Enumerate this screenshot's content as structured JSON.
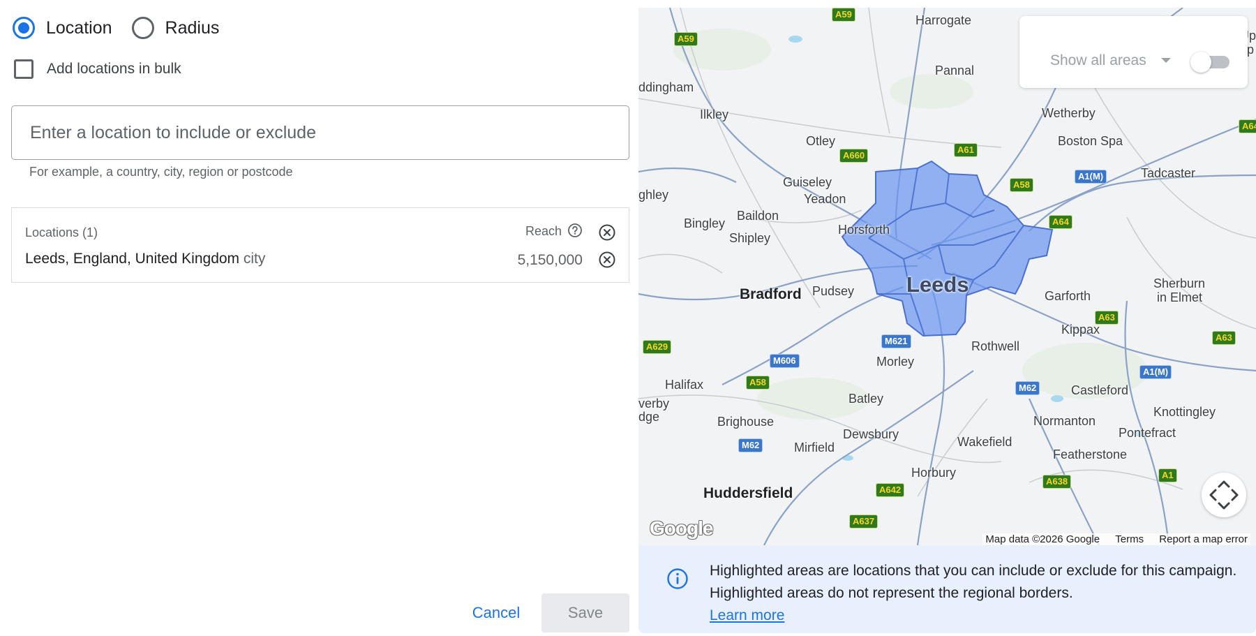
{
  "target_type": {
    "location_label": "Location",
    "radius_label": "Radius",
    "selected": "location"
  },
  "bulk": {
    "label": "Add locations in bulk",
    "checked": false
  },
  "search": {
    "placeholder": "Enter a location to include or exclude",
    "value": "",
    "helper": "For example, a country, city, region or postcode"
  },
  "locations": {
    "header": "Locations (1)",
    "reach_label": "Reach",
    "items": [
      {
        "name": "Leeds, England, United Kingdom",
        "type": "city",
        "reach": "5,150,000"
      }
    ]
  },
  "actions": {
    "cancel_label": "Cancel",
    "save_label": "Save",
    "save_disabled": true
  },
  "map": {
    "show_all_areas_label": "Show all areas",
    "show_all_areas_on": false,
    "highlight_color": "#6b96f0",
    "places": {
      "harrogate": "Harrogate",
      "pannal": "Pannal",
      "addingham": "ddingham",
      "ilkley": "Ilkley",
      "otley": "Otley",
      "wetherby": "Wetherby",
      "boston_spa": "Boston Spa",
      "tadcaster": "Tadcaster",
      "guiseley": "Guiseley",
      "yeadon": "Yeadon",
      "ghley": "ghley",
      "bingley": "Bingley",
      "baildon": "Baildon",
      "shipley": "Shipley",
      "horsforth": "Horsforth",
      "leeds": "Leeds",
      "bradford": "Bradford",
      "pudsey": "Pudsey",
      "garforth": "Garforth",
      "sherburn": "Sherburn",
      "in_elmet": "in Elmet",
      "kippax": "Kippax",
      "rothwell": "Rothwell",
      "morley": "Morley",
      "halifax": "Halifax",
      "batley": "Batley",
      "castleford": "Castleford",
      "knottingley": "Knottingley",
      "verby": "verby",
      "dge": "dge",
      "brighouse": "Brighouse",
      "dewsbury": "Dewsbury",
      "normanton": "Normanton",
      "pontefract": "Pontefract",
      "wakefield": "Wakefield",
      "mirfield": "Mirfield",
      "featherstone": "Featherstone",
      "horbury": "Horbury",
      "huddersfield": "Huddersfield",
      "up": "Up",
      "op": "op"
    },
    "roads": {
      "a59_top": "A59",
      "a59": "A59",
      "a660": "A660",
      "a61": "A61",
      "a58_ne": "A58",
      "a1m_top": "A1(M)",
      "a64": "A64",
      "a64_edge": "A64",
      "a63": "A63",
      "a63_east": "A63",
      "a629": "A629",
      "m606": "M606",
      "m621": "M621",
      "a58_w": "A58",
      "a1m": "A1(M)",
      "m62_e": "M62",
      "m62_w": "M62",
      "a642": "A642",
      "a638": "A638",
      "a1": "A1",
      "a637": "A637"
    },
    "logo": "Google",
    "attribution": {
      "data": "Map data ©2026 Google",
      "terms": "Terms",
      "report": "Report a map error"
    }
  },
  "banner": {
    "text": "Highlighted areas are locations that you can include or exclude for this campaign. Highlighted areas do not represent the regional borders.",
    "learn_more": "Learn more"
  },
  "colors": {
    "accent": "#1a73e8",
    "banner_bg": "#e8f0fe",
    "road_green": "#2f7a1e",
    "motorway_blue": "#3a76c9"
  }
}
